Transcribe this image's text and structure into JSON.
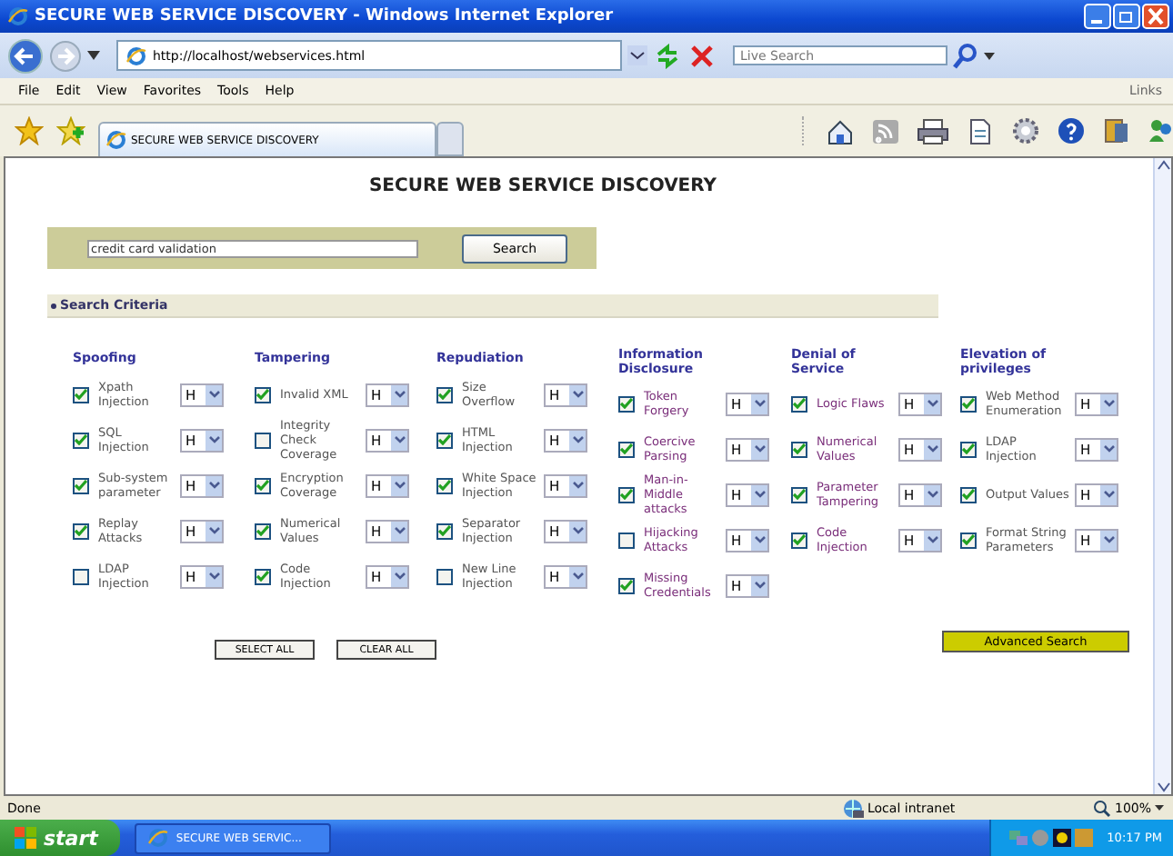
{
  "window": {
    "title": "SECURE WEB SERVICE DISCOVERY - Windows Internet Explorer"
  },
  "address_bar": {
    "url": "http://localhost/webservices.html",
    "search_placeholder": "Live Search"
  },
  "menu": [
    "File",
    "Edit",
    "View",
    "Favorites",
    "Tools",
    "Help"
  ],
  "links_label": "Links",
  "tabs": [
    {
      "label": "SECURE WEB SERVICE DISCOVERY",
      "selected": true
    }
  ],
  "page": {
    "heading": "SECURE WEB SERVICE DISCOVERY",
    "search": {
      "value": "credit card validation",
      "button": "Search"
    },
    "criteria_heading": "Search Criteria",
    "categories": [
      {
        "title": "Spoofing",
        "items": [
          {
            "label": "Xpath Injection",
            "checked": true,
            "severity": "H"
          },
          {
            "label": "SQL Injection",
            "checked": true,
            "severity": "H"
          },
          {
            "label": "Sub-system parameter",
            "checked": true,
            "severity": "H"
          },
          {
            "label": "Replay Attacks",
            "checked": true,
            "severity": "H"
          },
          {
            "label": "LDAP Injection",
            "checked": false,
            "severity": "H"
          }
        ]
      },
      {
        "title": "Tampering",
        "items": [
          {
            "label": "Invalid XML",
            "checked": true,
            "severity": "H"
          },
          {
            "label": "Integrity Check Coverage",
            "checked": false,
            "severity": "H"
          },
          {
            "label": "Encryption Coverage",
            "checked": true,
            "severity": "H"
          },
          {
            "label": "Numerical Values",
            "checked": true,
            "severity": "H"
          },
          {
            "label": "Code Injection",
            "checked": true,
            "severity": "H"
          }
        ]
      },
      {
        "title": "Repudiation",
        "items": [
          {
            "label": "Size Overflow",
            "checked": true,
            "severity": "H"
          },
          {
            "label": "HTML Injection",
            "checked": true,
            "severity": "H"
          },
          {
            "label": "White Space Injection",
            "checked": true,
            "severity": "H"
          },
          {
            "label": "Separator Injection",
            "checked": true,
            "severity": "H"
          },
          {
            "label": "New Line Injection",
            "checked": false,
            "severity": "H"
          }
        ]
      },
      {
        "title": "Information Disclosure",
        "items": [
          {
            "label": "Token Forgery",
            "checked": true,
            "severity": "H"
          },
          {
            "label": "Coercive Parsing",
            "checked": true,
            "severity": "H"
          },
          {
            "label": "Man-in-Middle attacks",
            "checked": true,
            "severity": "H"
          },
          {
            "label": "Hijacking Attacks",
            "checked": false,
            "severity": "H"
          },
          {
            "label": "Missing Credentials",
            "checked": true,
            "severity": "H"
          }
        ]
      },
      {
        "title": "Denial of Service",
        "items": [
          {
            "label": "Logic Flaws",
            "checked": true,
            "severity": "H"
          },
          {
            "label": "Numerical Values",
            "checked": true,
            "severity": "H"
          },
          {
            "label": "Parameter Tampering",
            "checked": true,
            "severity": "H"
          },
          {
            "label": "Code Injection",
            "checked": true,
            "severity": "H"
          }
        ]
      },
      {
        "title": "Elevation of privileges",
        "items": [
          {
            "label": "Web Method Enumeration",
            "checked": true,
            "severity": "H"
          },
          {
            "label": "LDAP Injection",
            "checked": true,
            "severity": "H"
          },
          {
            "label": "Output Values",
            "checked": true,
            "severity": "H"
          },
          {
            "label": "Format String Parameters",
            "checked": true,
            "severity": "H"
          }
        ]
      }
    ],
    "buttons": [
      "SELECT ALL",
      "CLEAR ALL"
    ],
    "advanced_button": "Advanced Search"
  },
  "status_bar": {
    "text": "Done",
    "zone": "Local intranet",
    "zoom": "100%"
  },
  "taskbar": {
    "start": "start",
    "task": "SECURE WEB SERVIC...",
    "clock": "10:17 PM"
  }
}
